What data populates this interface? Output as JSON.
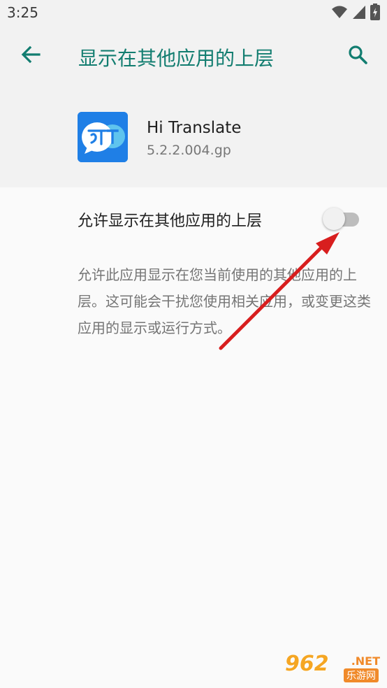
{
  "status_bar": {
    "time": "3:25",
    "icons": [
      "wifi-icon",
      "signal-icon",
      "battery-charging-icon"
    ]
  },
  "app_bar": {
    "title": "显示在其他应用的上层",
    "back_icon": "arrow-back-icon",
    "search_icon": "search-icon",
    "accent_color": "#127d70"
  },
  "app_info": {
    "name": "Hi Translate",
    "version": "5.2.2.004.gp",
    "icon_color": "#1f7fe6"
  },
  "setting": {
    "label": "允许显示在其他应用的上层",
    "enabled": false,
    "description": "允许此应用显示在您当前使用的其他应用的上层。这可能会干扰您使用相关应用，或变更这类应用的显示或运行方式。"
  },
  "watermark": {
    "brand": "962",
    "suffix": ".NET",
    "cn": "乐游网"
  }
}
